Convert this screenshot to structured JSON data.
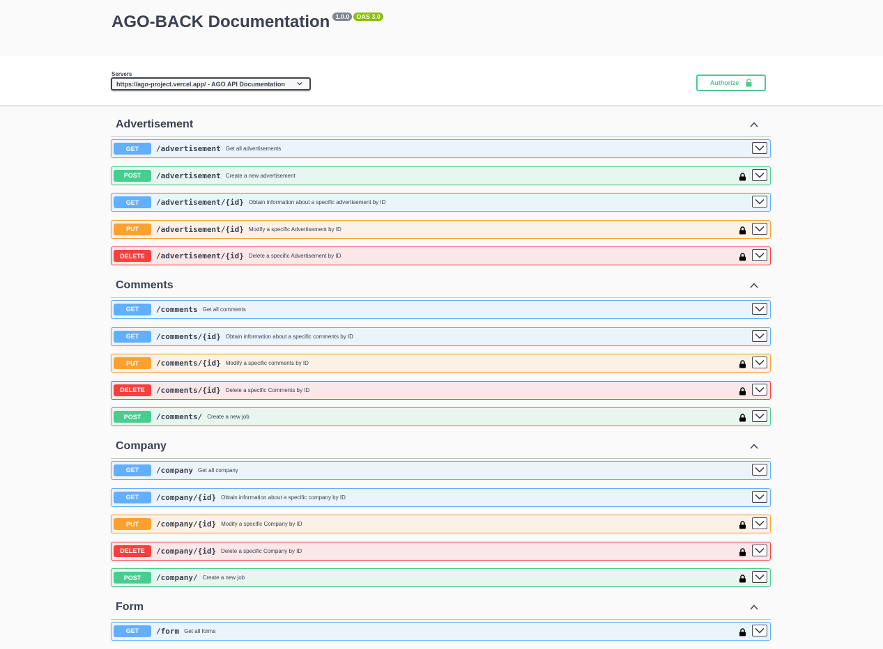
{
  "info": {
    "title": "AGO-BACK Documentation",
    "version_badge": "1.0.0",
    "oas_badge": "OAS 3.0"
  },
  "scheme": {
    "servers_label": "Servers",
    "selected_server": "https://ago-project.vercel.app/ - AGO API Documentation",
    "authorize_label": "Authorize"
  },
  "tags": [
    {
      "name": "Advertisement",
      "operations": [
        {
          "method": "GET",
          "path": "/advertisement",
          "summary": "Get all advertisements",
          "locked": false
        },
        {
          "method": "POST",
          "path": "/advertisement",
          "summary": "Create a new advertisement",
          "locked": true
        },
        {
          "method": "GET",
          "path": "/advertisement/{id}",
          "summary": "Obtain information about a specific advertisement by ID",
          "locked": false
        },
        {
          "method": "PUT",
          "path": "/advertisement/{id}",
          "summary": "Modify a specific Advertisement by ID",
          "locked": true
        },
        {
          "method": "DELETE",
          "path": "/advertisement/{id}",
          "summary": "Delete a specific Advertisement by ID",
          "locked": true
        }
      ]
    },
    {
      "name": "Comments",
      "operations": [
        {
          "method": "GET",
          "path": "/comments",
          "summary": "Get all comments",
          "locked": false
        },
        {
          "method": "GET",
          "path": "/comments/{id}",
          "summary": "Obtain information about a specific comments by ID",
          "locked": false
        },
        {
          "method": "PUT",
          "path": "/comments/{id}",
          "summary": "Modify a specific comments by ID",
          "locked": true
        },
        {
          "method": "DELETE",
          "path": "/comments/{id}",
          "summary": "Delete a specific Comments by ID",
          "locked": true
        },
        {
          "method": "POST",
          "path": "/comments/",
          "summary": "Create a new job",
          "locked": true
        }
      ]
    },
    {
      "name": "Company",
      "operations": [
        {
          "method": "GET",
          "path": "/company",
          "summary": "Get all company",
          "locked": false
        },
        {
          "method": "GET",
          "path": "/company/{id}",
          "summary": "Obtain information about a specific company by ID",
          "locked": false
        },
        {
          "method": "PUT",
          "path": "/company/{id}",
          "summary": "Modify a specific Company by ID",
          "locked": true
        },
        {
          "method": "DELETE",
          "path": "/company/{id}",
          "summary": "Delete a specific Company by ID",
          "locked": true
        },
        {
          "method": "POST",
          "path": "/company/",
          "summary": "Create a new job",
          "locked": true
        }
      ]
    },
    {
      "name": "Form",
      "operations": [
        {
          "method": "GET",
          "path": "/form",
          "summary": "Get all forms",
          "locked": true
        }
      ]
    }
  ],
  "icons": {
    "collapse": "chevron-up-icon",
    "expand": "chevron-down-icon",
    "lock": "lock-icon"
  },
  "colors": {
    "get": "#61affe",
    "post": "#49cc90",
    "put": "#fca130",
    "delete": "#f93e3e"
  }
}
